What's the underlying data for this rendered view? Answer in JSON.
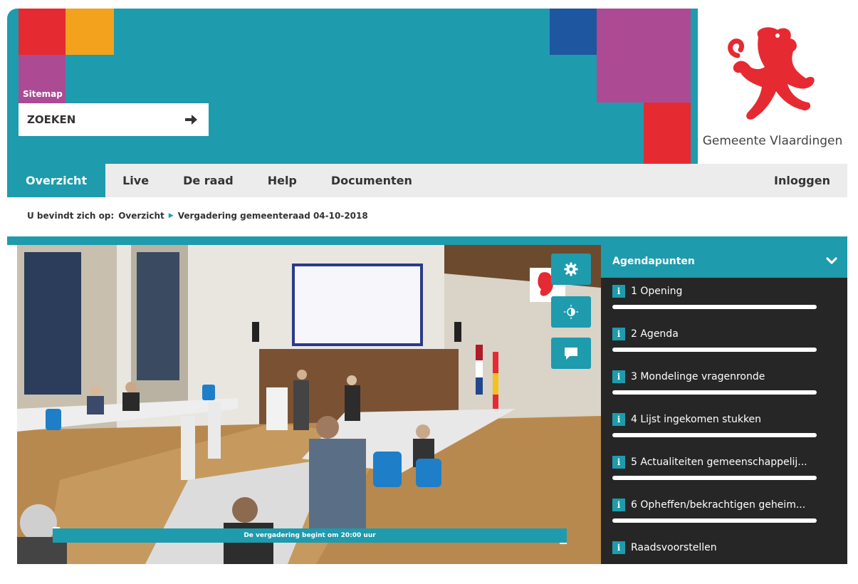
{
  "header": {
    "sitemap_label": "Sitemap",
    "search": {
      "placeholder": "ZOEKEN",
      "value": ""
    },
    "logo_text": "Gemeente Vlaardingen",
    "colors": {
      "teal": "#1e9bad",
      "red": "#e62a32",
      "orange": "#f3a21d",
      "purple": "#ad4a94",
      "blue": "#1e56a0"
    }
  },
  "nav": {
    "items": [
      {
        "label": "Overzicht",
        "active": true
      },
      {
        "label": "Live",
        "active": false
      },
      {
        "label": "De raad",
        "active": false
      },
      {
        "label": "Help",
        "active": false
      },
      {
        "label": "Documenten",
        "active": false
      }
    ],
    "login_label": "Inloggen"
  },
  "breadcrumb": {
    "prefix": "U bevindt zich op:",
    "items": [
      "Overzicht",
      "Vergadering gemeenteraad 04-10-2018"
    ]
  },
  "video": {
    "status_text": "De vergadering begint om 20:00 uur",
    "buttons": [
      "gear-icon",
      "contrast-icon",
      "chat-icon"
    ]
  },
  "agenda": {
    "title": "Agendapunten",
    "items": [
      {
        "label": "1 Opening"
      },
      {
        "label": "2 Agenda"
      },
      {
        "label": "3 Mondelinge vragenronde"
      },
      {
        "label": "4 Lijst ingekomen stukken"
      },
      {
        "label": "5 Actualiteiten gemeenschappelij..."
      },
      {
        "label": "6 Opheffen/bekrachtigen geheim..."
      },
      {
        "label": "Raadsvoorstellen"
      }
    ]
  }
}
